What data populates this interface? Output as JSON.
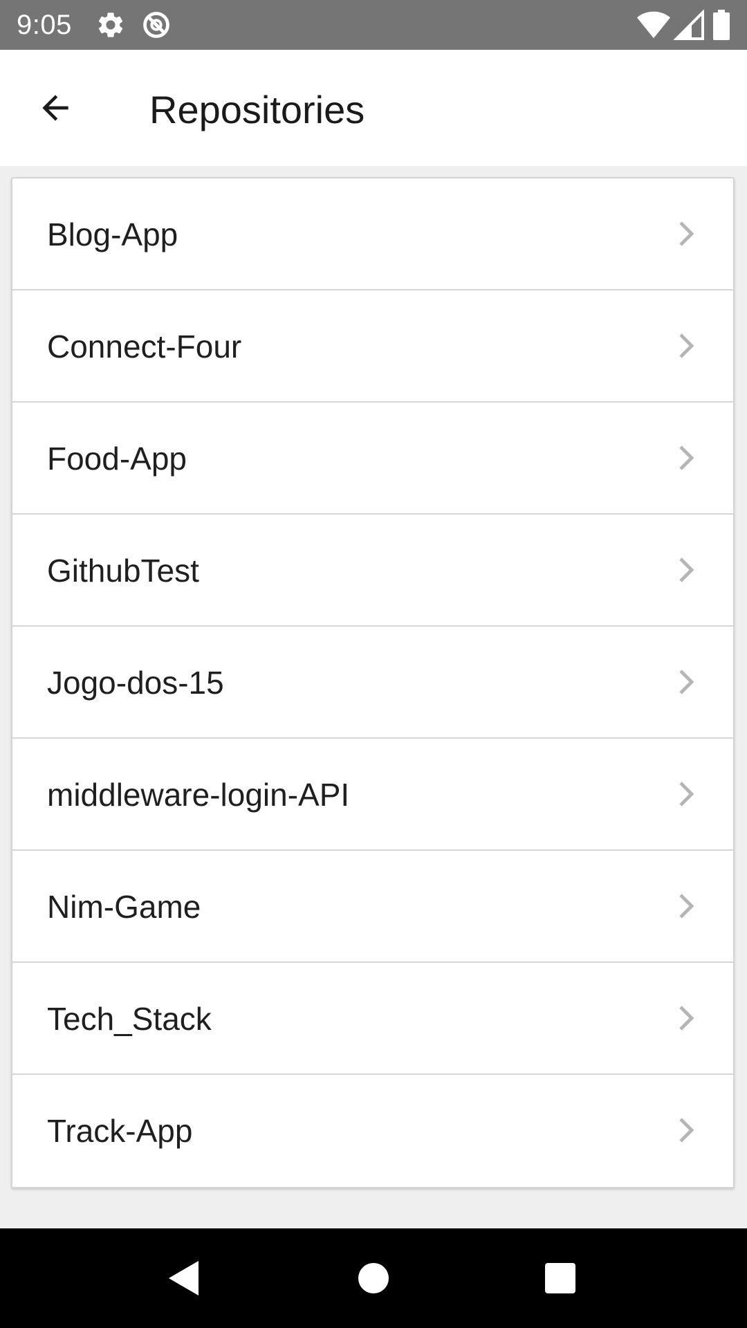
{
  "status_bar": {
    "time": "9:05",
    "icons": [
      "gear-icon",
      "do-not-disturb-icon",
      "wifi-icon",
      "cellular-signal-icon",
      "battery-icon"
    ],
    "background": "#757575"
  },
  "app_bar": {
    "title": "Repositories",
    "back_icon": "arrow-back-icon"
  },
  "repositories": [
    {
      "label": "Blog-App"
    },
    {
      "label": "Connect-Four"
    },
    {
      "label": "Food-App"
    },
    {
      "label": "GithubTest"
    },
    {
      "label": "Jogo-dos-15"
    },
    {
      "label": "middleware-login-API"
    },
    {
      "label": "Nim-Game"
    },
    {
      "label": "Tech_Stack"
    },
    {
      "label": "Track-App"
    }
  ],
  "nav_bar": {
    "icons": [
      "nav-back-icon",
      "nav-home-icon",
      "nav-recents-icon"
    ],
    "background": "#000000"
  },
  "colors": {
    "page_background": "#efefef",
    "card_background": "#ffffff",
    "divider": "#d6d6d6",
    "chevron": "#b5b5b5"
  }
}
